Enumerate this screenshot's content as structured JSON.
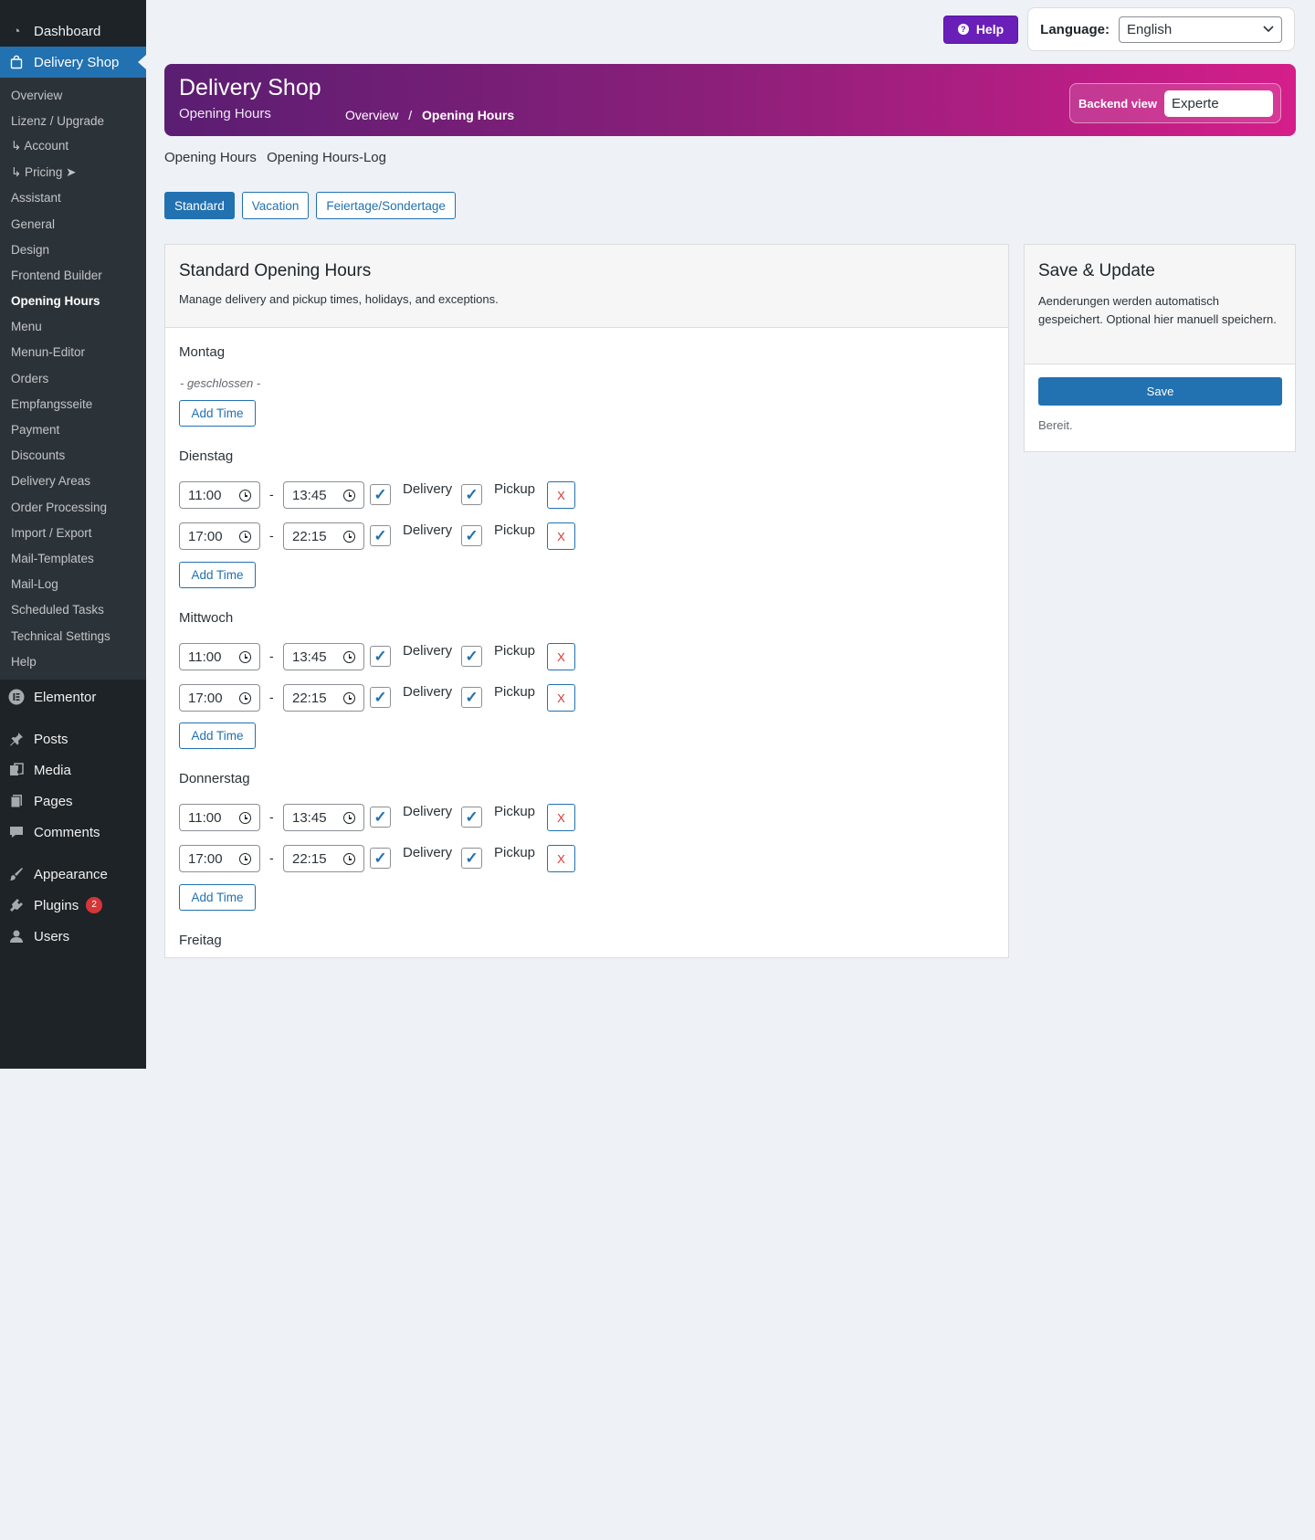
{
  "sidebar": {
    "top_items": {
      "dashboard": "Dashboard",
      "delivery_shop": "Delivery Shop"
    },
    "submenu": [
      "Overview",
      "Lizenz / Upgrade",
      "↳ Account",
      "↳ Pricing ➤",
      "Assistant",
      "General",
      "Design",
      "Frontend Builder",
      "Opening Hours",
      "Menu",
      "Menun-Editor",
      "Orders",
      "Empfangsseite",
      "Payment",
      "Discounts",
      "Delivery Areas",
      "Order Processing",
      "Import / Export",
      "Mail-Templates",
      "Mail-Log",
      "Scheduled Tasks",
      "Technical Settings",
      "Help"
    ],
    "bottom_items": {
      "elementor": "Elementor",
      "posts": "Posts",
      "media": "Media",
      "pages": "Pages",
      "comments": "Comments",
      "appearance": "Appearance",
      "plugins": "Plugins",
      "plugins_badge": "2",
      "users": "Users"
    }
  },
  "topbar": {
    "help_label": "Help",
    "help_icon": "?",
    "language_label": "Language:",
    "language_value": "English"
  },
  "hero": {
    "title": "Delivery Shop",
    "subtitle": "Opening Hours",
    "crumb_overview": "Overview",
    "crumb_sep": "/",
    "crumb_current": "Opening Hours",
    "backend_view_label": "Backend view",
    "backend_view_value": "Experte"
  },
  "subnav": {
    "opening_hours": "Opening Hours",
    "opening_hours_log": "Opening Hours-Log"
  },
  "tabs": {
    "standard": "Standard",
    "vacation": "Vacation",
    "holidays": "Feiertage/Sondertage"
  },
  "main": {
    "title": "Standard Opening Hours",
    "description": "Manage delivery and pickup times, holidays, and exceptions.",
    "add_time_label": "Add Time",
    "delivery_label": "Delivery",
    "pickup_label": "Pickup",
    "remove_label": "X",
    "range_sep": "-",
    "days": [
      {
        "name": "Montag",
        "closed_text": "- geschlossen -"
      },
      {
        "name": "Dienstag",
        "slots": [
          {
            "from": "11:00",
            "to": "13:45",
            "delivery": true,
            "pickup": true
          },
          {
            "from": "17:00",
            "to": "22:15",
            "delivery": true,
            "pickup": true
          }
        ]
      },
      {
        "name": "Mittwoch",
        "slots": [
          {
            "from": "11:00",
            "to": "13:45",
            "delivery": true,
            "pickup": true
          },
          {
            "from": "17:00",
            "to": "22:15",
            "delivery": true,
            "pickup": true
          }
        ]
      },
      {
        "name": "Donnerstag",
        "slots": [
          {
            "from": "11:00",
            "to": "13:45",
            "delivery": true,
            "pickup": true
          },
          {
            "from": "17:00",
            "to": "22:15",
            "delivery": true,
            "pickup": true
          }
        ]
      },
      {
        "name": "Freitag"
      }
    ]
  },
  "save_panel": {
    "title": "Save & Update",
    "description": "Aenderungen werden automatisch gespeichert. Optional hier manuell speichern.",
    "save_label": "Save",
    "status": "Bereit."
  },
  "colors": {
    "accent": "#2271b1",
    "sidebar_bg": "#1d2327",
    "help_button": "#6a1fb8",
    "hero_gradient_start": "#5a1e72",
    "hero_gradient_end": "#d51e8a",
    "danger": "#d63638"
  },
  "icons": {
    "dashboard": "dashboard-icon",
    "delivery_shop": "shopping-bag-icon",
    "elementor": "elementor-icon",
    "posts": "pushpin-icon",
    "media": "media-icon",
    "pages": "pages-icon",
    "comments": "comment-icon",
    "appearance": "paintbrush-icon",
    "plugins": "plugin-icon",
    "users": "user-icon",
    "time_input": "clock-icon",
    "select": "chevron-down-icon"
  }
}
